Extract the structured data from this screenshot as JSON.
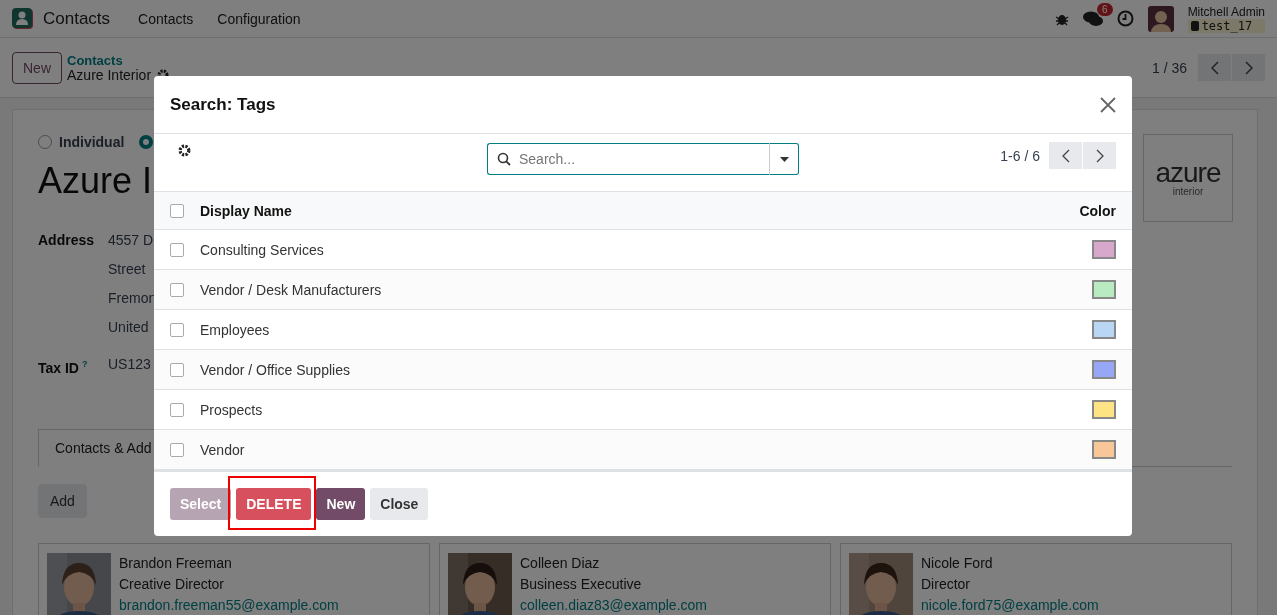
{
  "navbar": {
    "app_name": "Contacts",
    "menu": [
      "Contacts",
      "Configuration"
    ],
    "messages_badge": "6",
    "user": "Mitchell Admin",
    "database": "test_17"
  },
  "control_panel": {
    "new_button": "New",
    "breadcrumb_parent": "Contacts",
    "breadcrumb_current": "Azure Interior",
    "pager": "1 / 36"
  },
  "form": {
    "company_types": [
      {
        "label": "Individual",
        "selected": false
      },
      {
        "selected": true
      }
    ],
    "title": "Azure I",
    "fields": [
      {
        "label": "Address",
        "values": [
          "4557 D",
          "Street",
          "Fremon",
          "United"
        ]
      },
      {
        "label": "Tax ID",
        "help": "?",
        "values": [
          "US123"
        ]
      }
    ],
    "logo": {
      "name": "azure",
      "tagline": "interior"
    },
    "tabs": [
      {
        "label": "Contacts & Add",
        "selected": true
      }
    ],
    "add_button": "Add",
    "contacts": [
      {
        "name": "Brandon Freeman",
        "job": "Creative Director",
        "email": "brandon.freeman55@example.com"
      },
      {
        "name": "Colleen Diaz",
        "job": "Business Executive",
        "email": "colleen.diaz83@example.com"
      },
      {
        "name": "Nicole Ford",
        "job": "Director",
        "email": "nicole.ford75@example.com"
      }
    ]
  },
  "dialog": {
    "title": "Search: Tags",
    "search": {
      "placeholder": "Search..."
    },
    "pager": "1-6 / 6",
    "select_all_checked": false,
    "columns": [
      "Display Name",
      "Color"
    ],
    "rows": [
      {
        "name": "Consulting Services",
        "color": "#d8a8cc",
        "checked": false
      },
      {
        "name": "Vendor / Desk Manufacturers",
        "color": "#b8ecc0",
        "checked": false
      },
      {
        "name": "Employees",
        "color": "#b9d6f5",
        "checked": false
      },
      {
        "name": "Vendor / Office Supplies",
        "color": "#97a6f5",
        "checked": false
      },
      {
        "name": "Prospects",
        "color": "#fde384",
        "checked": false
      },
      {
        "name": "Vendor",
        "color": "#f7c797",
        "checked": false
      }
    ],
    "buttons": [
      {
        "label": "Select",
        "kind": "primary",
        "disabled": true,
        "highlighted": false
      },
      {
        "label": "DELETE",
        "kind": "danger",
        "disabled": false,
        "highlighted": true
      },
      {
        "label": "New",
        "kind": "primary",
        "disabled": false,
        "highlighted": false
      },
      {
        "label": "Close",
        "kind": "secondary",
        "disabled": false,
        "highlighted": false
      }
    ]
  }
}
